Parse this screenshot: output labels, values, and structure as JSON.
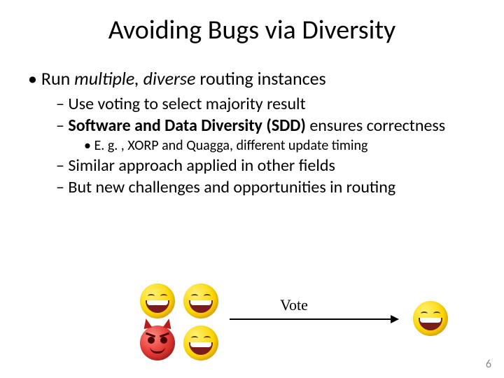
{
  "title": "Avoiding Bugs via Diversity",
  "bullets": {
    "l1": {
      "pre": "Run ",
      "em": "multiple, diverse",
      "post": " routing instances"
    },
    "l2a": "Use voting to select majority result",
    "l2b": {
      "strong": "Software and Data Diversity (SDD) ",
      "rest": "ensures correctness"
    },
    "l3": "E. g. , XORP and Quagga, different update timing",
    "l2c": "Similar approach applied in other fields",
    "l2d": "But new challenges and opportunities in routing"
  },
  "vote_label": "Vote",
  "page_number": "6"
}
